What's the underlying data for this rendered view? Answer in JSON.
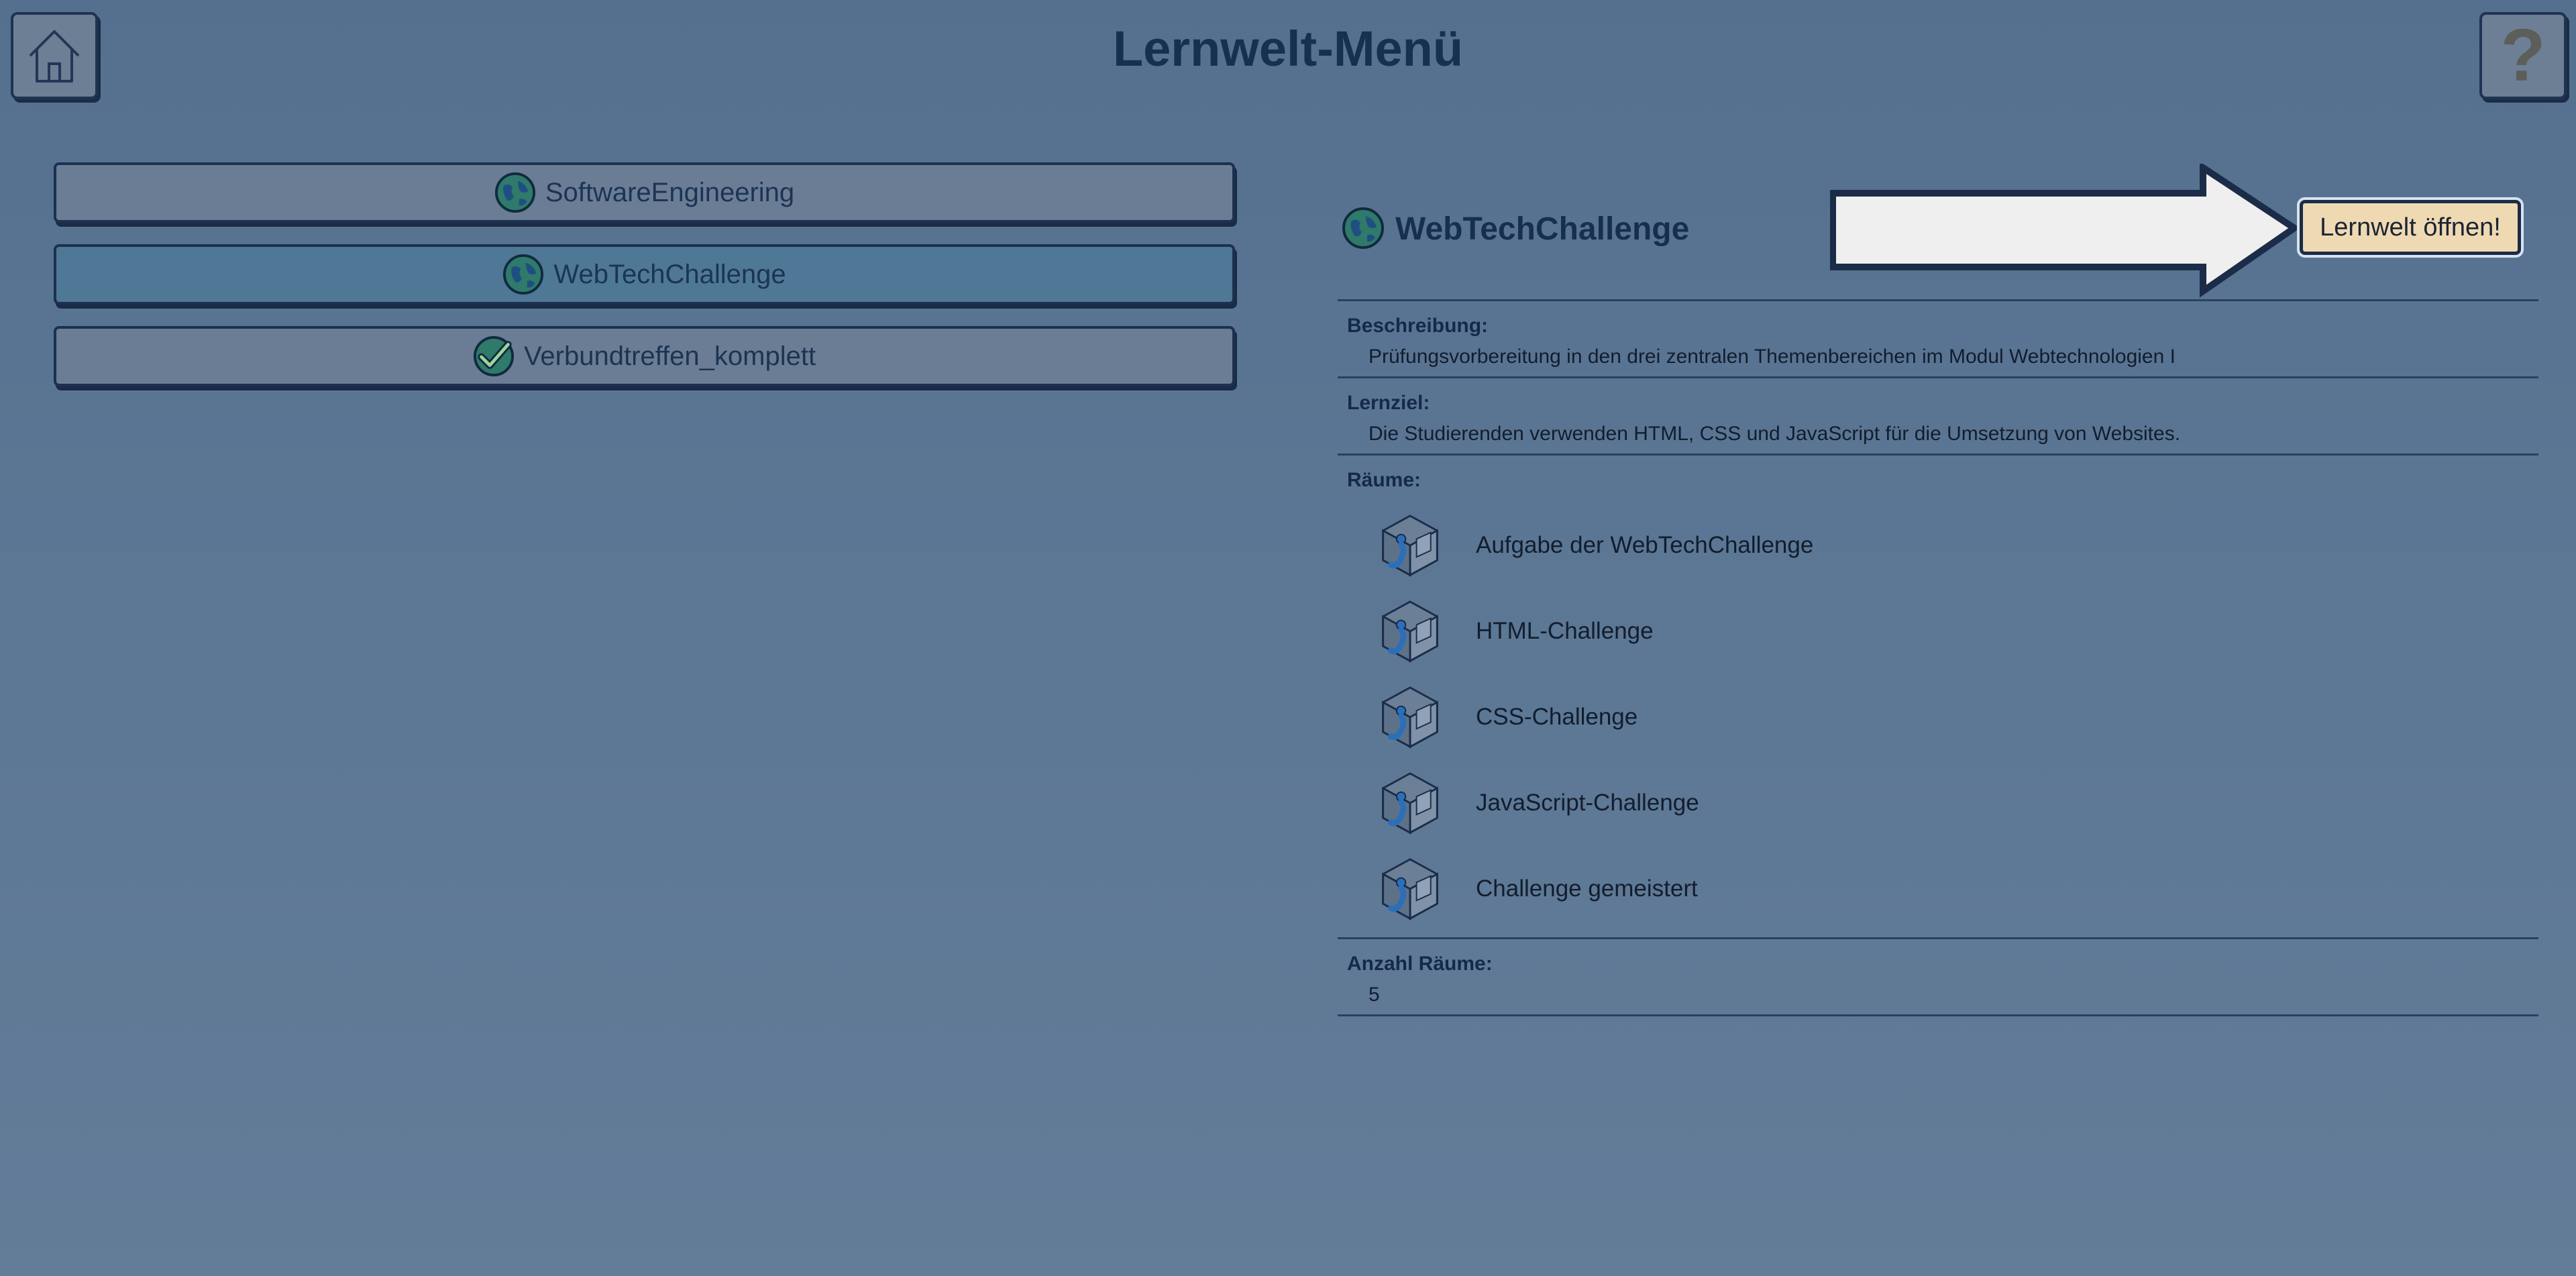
{
  "title": "Lernwelt-Menü",
  "header": {
    "home_icon": "home-icon",
    "help_icon": "question-mark-icon",
    "help_glyph": "?"
  },
  "worlds": [
    {
      "label": "SoftwareEngineering",
      "icon": "globe-icon",
      "selected": false
    },
    {
      "label": "WebTechChallenge",
      "icon": "globe-icon",
      "selected": true
    },
    {
      "label": "Verbundtreffen_komplett",
      "icon": "check-icon",
      "selected": false
    }
  ],
  "detail": {
    "title": "WebTechChallenge",
    "open_button": "Lernwelt öffnen!",
    "description_label": "Beschreibung:",
    "description": "Prüfungsvorbereitung in den drei zentralen Themenbereichen im Modul Webtechnologien I",
    "goal_label": "Lernziel:",
    "goal": "Die Studierenden verwenden HTML, CSS und JavaScript für die Umsetzung von Websites.",
    "rooms_label": "Räume:",
    "rooms": [
      "Aufgabe der WebTechChallenge",
      "HTML-Challenge",
      "CSS-Challenge",
      "JavaScript-Challenge",
      "Challenge gemeistert"
    ],
    "room_count_label": "Anzahl Räume:",
    "room_count": "5"
  },
  "colors": {
    "accent_button": "#efd9b3",
    "selected_item": "#4e7895",
    "item": "#6a7d94",
    "globe": "#2f7a6a"
  }
}
